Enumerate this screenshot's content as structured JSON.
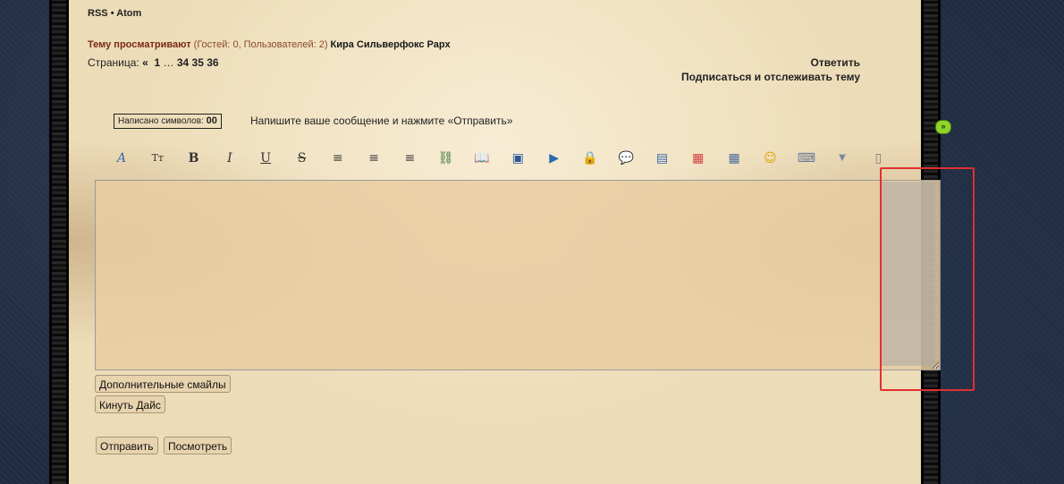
{
  "feeds": {
    "rss": "RSS",
    "separator": "•",
    "atom": "Atom"
  },
  "viewers": {
    "label": "Тему просматривают",
    "counts": "(Гостей: 0, Пользователей: 2)",
    "users": "Кира Сильверфокс Рарх"
  },
  "pagination": {
    "label": "Страница:",
    "prev": "«",
    "first": "1",
    "ellipsis": "…",
    "pages": [
      "34",
      "35",
      "36"
    ]
  },
  "actions": {
    "reply": "Ответить",
    "subscribe": "Подписаться и отслеживать тему"
  },
  "counter": {
    "label": "Написано символов:",
    "value": "00"
  },
  "hint": "Напишите ваше сообщение и нажмите «Отправить»",
  "toolbar": [
    {
      "name": "font-icon",
      "glyph": "A",
      "color": "#3a6ab0"
    },
    {
      "name": "font-size-icon",
      "glyph": "Tт",
      "color": "#333"
    },
    {
      "name": "bold-icon",
      "glyph": "B",
      "color": "#333"
    },
    {
      "name": "italic-icon",
      "glyph": "I",
      "color": "#333"
    },
    {
      "name": "underline-icon",
      "glyph": "U",
      "color": "#333"
    },
    {
      "name": "strikethrough-icon",
      "glyph": "S",
      "color": "#333"
    },
    {
      "name": "align-left-icon",
      "glyph": "≡",
      "color": "#333"
    },
    {
      "name": "align-center-icon",
      "glyph": "≡",
      "color": "#333"
    },
    {
      "name": "align-right-icon",
      "glyph": "≡",
      "color": "#333"
    },
    {
      "name": "link-icon",
      "glyph": "⛓",
      "color": "#2a6a2a"
    },
    {
      "name": "book-icon",
      "glyph": "📖",
      "color": "#2a5a9a"
    },
    {
      "name": "image-icon",
      "glyph": "▣",
      "color": "#2a5a9a"
    },
    {
      "name": "play-icon",
      "glyph": "▶",
      "color": "#2a6ab0"
    },
    {
      "name": "lock-icon",
      "glyph": "🔒",
      "color": "#c89a20"
    },
    {
      "name": "speech-bubble-icon",
      "glyph": "💬",
      "color": "#4a6a9a"
    },
    {
      "name": "document-icon",
      "glyph": "▤",
      "color": "#3a6ab0"
    },
    {
      "name": "color-palette-icon",
      "glyph": "▦",
      "color": "#d04040"
    },
    {
      "name": "table-icon",
      "glyph": "▦",
      "color": "#4a6a9a"
    },
    {
      "name": "smiley-icon",
      "glyph": "☺",
      "color": "#e0a000"
    },
    {
      "name": "keyboard-icon",
      "glyph": "⌨",
      "color": "#6a7a9a"
    },
    {
      "name": "dropdown-arrow-icon",
      "glyph": "▼",
      "color": "#7a8aa0"
    },
    {
      "name": "scroll-icon",
      "glyph": "▯",
      "color": "#7a7a7a"
    }
  ],
  "buttons": {
    "more_smileys": "Дополнительные смайлы",
    "roll_dice": "Кинуть Дайс",
    "submit": "Отправить",
    "preview": "Посмотреть"
  },
  "green_toggle": "»"
}
